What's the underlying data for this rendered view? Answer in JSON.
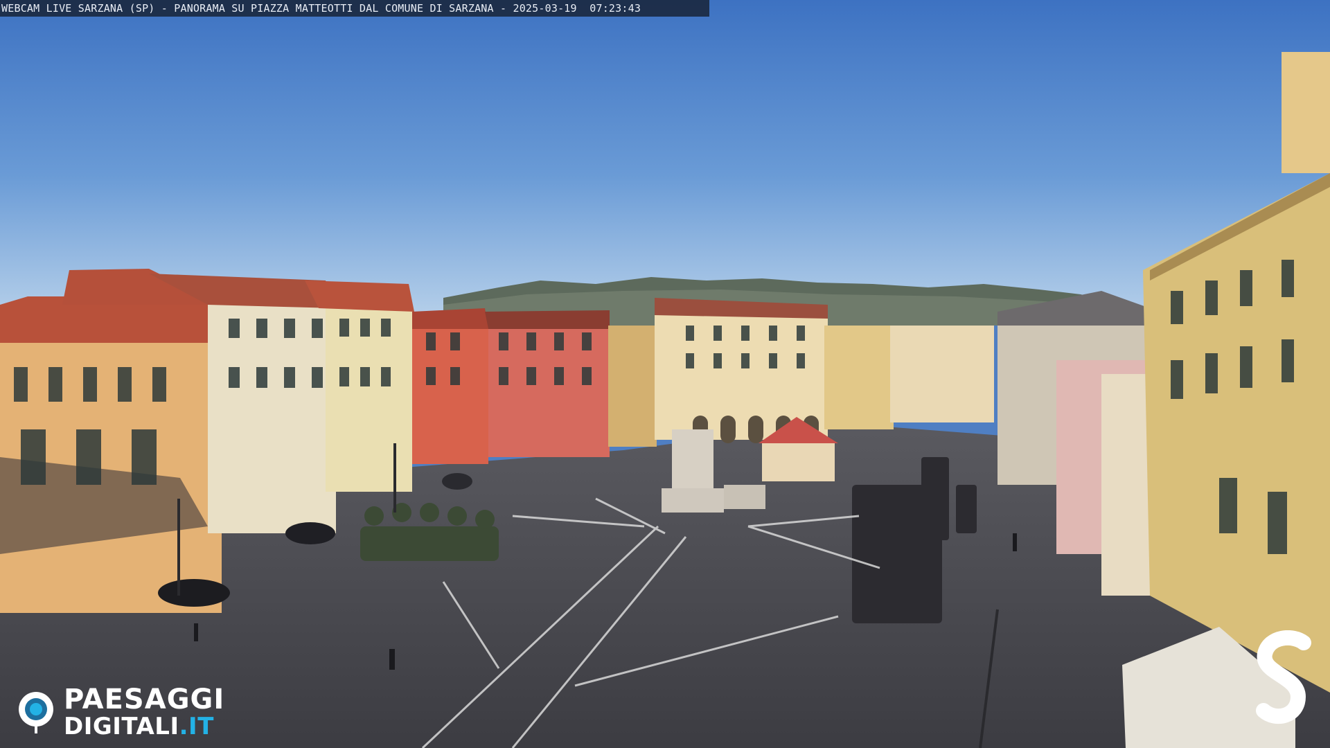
{
  "overlay": {
    "caption": "WEBCAM LIVE SARZANA (SP) - PANORAMA SU PIAZZA MATTEOTTI DAL COMUNE DI SARZANA - 2025-03-19  07:23:43"
  },
  "watermark": {
    "line1": "PAESAGGI",
    "line2_main": "DIGITALI",
    "line2_tld": ".IT",
    "brand_letter": "S"
  },
  "colors": {
    "sky_top": "#3f74c4",
    "sky_bottom": "#a8c6e6",
    "pavement": "#4a4a4f",
    "accent_blue": "#23b2e6"
  }
}
